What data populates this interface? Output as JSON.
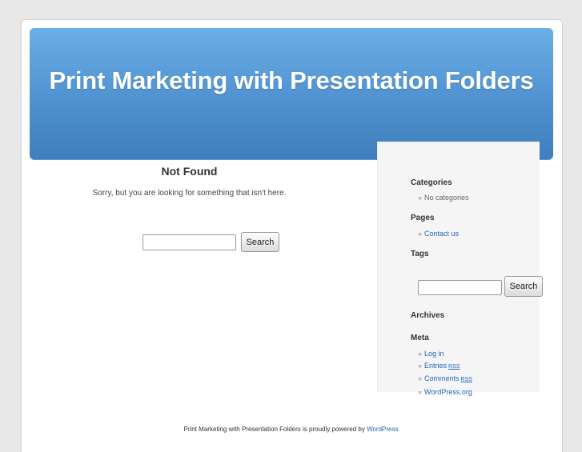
{
  "header": {
    "title": "Print Marketing with Presentation Folders"
  },
  "main": {
    "heading": "Not Found",
    "message": "Sorry, but you are looking for something that isn't here.",
    "search": {
      "value": "",
      "button": "Search"
    }
  },
  "sidebar": {
    "categories": {
      "heading": "Categories",
      "items": [
        "No categories"
      ]
    },
    "pages": {
      "heading": "Pages",
      "items": [
        "Contact us"
      ]
    },
    "tags": {
      "heading": "Tags"
    },
    "search": {
      "value": "",
      "button": "Search"
    },
    "archives": {
      "heading": "Archives"
    },
    "meta": {
      "heading": "Meta",
      "items": [
        "Log in",
        "Entries",
        "Comments",
        "WordPress.org"
      ],
      "rss_label": "RSS"
    }
  },
  "footer": {
    "text": "Print Marketing with Presentation Folders is proudly powered by",
    "link": "WordPress"
  },
  "colors": {
    "header_top": "#6aafe8",
    "header_bottom": "#3f7ebd",
    "link": "#2266b8",
    "background": "#e8e8e8"
  }
}
